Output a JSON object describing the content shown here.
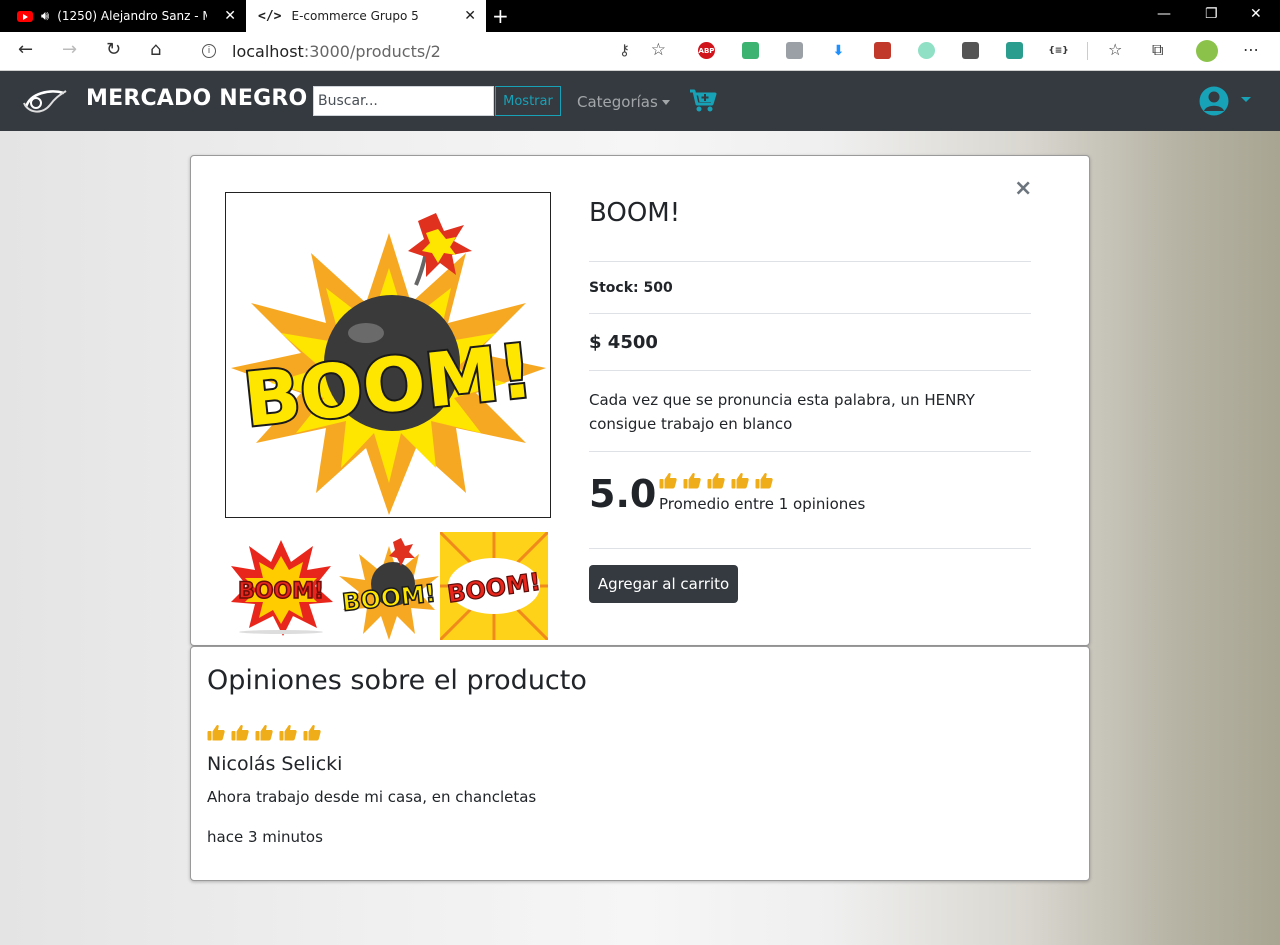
{
  "browser": {
    "tabs": [
      {
        "title": "(1250) Alejandro Sanz - Mer",
        "icon": "youtube-icon",
        "close": "✕"
      },
      {
        "title": "E-commerce Grupo 5",
        "icon": "code-icon",
        "close": "✕"
      }
    ],
    "url_host": "localhost",
    "url_path": ":3000/products/2",
    "extensions": [
      "ABP"
    ]
  },
  "navbar": {
    "brand": "MERCADO NEGRO",
    "search_placeholder": "Buscar...",
    "search_button": "Mostrar",
    "categories_label": "Categorías",
    "accent_color": "#17a2b8",
    "bg_color": "#343a40"
  },
  "product": {
    "title": "BOOM!",
    "stock": "Stock: 500",
    "price": "$ 4500",
    "description": "Cada vez que se pronuncia esta palabra, un HENRY consigue trabajo en blanco",
    "rating_score": "5.0",
    "rating_count_text": "Promedio entre 1 opiniones",
    "rating_thumbs": 5,
    "add_to_cart": "Agregar al carrito",
    "close": "×",
    "main_image_text": "BOOM!",
    "thumbnail_texts": [
      "BOOM!",
      "BOOM!",
      "BOOM!"
    ]
  },
  "reviews": {
    "title": "Opiniones sobre el producto",
    "items": [
      {
        "rating": 5,
        "author": "Nicolás Selicki",
        "text": "Ahora trabajo desde mi casa, en chancletas",
        "time": "hace 3 minutos"
      }
    ]
  }
}
